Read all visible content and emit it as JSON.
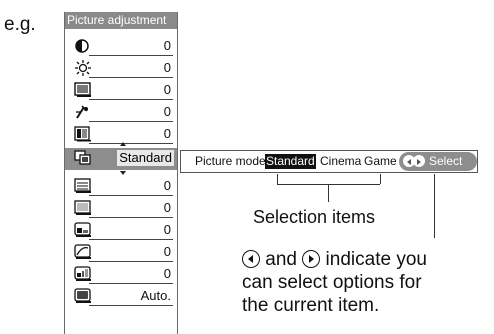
{
  "example_label": "e.g.",
  "panel": {
    "title": "Picture adjustment",
    "rows": [
      {
        "icon": "contrast-icon",
        "value": "0"
      },
      {
        "icon": "brightness-icon",
        "value": "0"
      },
      {
        "icon": "color-icon",
        "value": "0"
      },
      {
        "icon": "sharpness-icon",
        "value": "0"
      },
      {
        "icon": "tint-icon",
        "value": "0"
      },
      {
        "icon": "picture-mode-icon",
        "value": "Standard",
        "selected": true
      },
      {
        "icon": "color-temp-icon",
        "value": "0"
      },
      {
        "icon": "noise-reduction-icon",
        "value": "0"
      },
      {
        "icon": "black-level-icon",
        "value": "0"
      },
      {
        "icon": "gamma-icon",
        "value": "0"
      },
      {
        "icon": "white-balance-icon",
        "value": "0"
      },
      {
        "icon": "auto-mode-icon",
        "value": "Auto."
      }
    ]
  },
  "option_bar": {
    "label": "Picture mode",
    "options": [
      "Standard",
      "Cinema",
      "Game"
    ],
    "selected": "Standard",
    "hint": "Select"
  },
  "annotations": {
    "selection_items": "Selection items",
    "line1_text": "and",
    "line1_end": "indicate you",
    "line2": "can select options for",
    "line3": "the current item."
  }
}
